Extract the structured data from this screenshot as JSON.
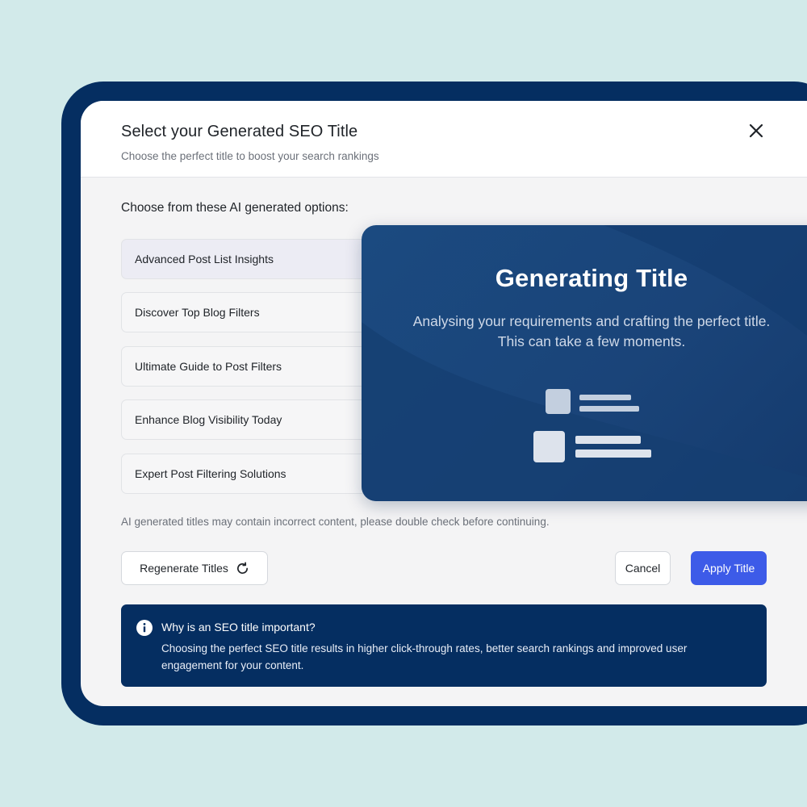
{
  "modal": {
    "title": "Select your Generated SEO Title",
    "subtitle": "Choose the perfect title to boost your search rankings",
    "close_icon": "close-icon"
  },
  "options": {
    "heading": "Choose from these AI generated options:",
    "items": [
      "Advanced Post List Insights",
      "Discover Top Blog Filters",
      "Ultimate Guide to Post Filters",
      "Enhance Blog Visibility Today",
      "Expert Post Filtering Solutions"
    ]
  },
  "disclaimer": "AI generated titles may contain incorrect content, please double check before continuing.",
  "buttons": {
    "regenerate": "Regenerate Titles",
    "regenerate_icon": "refresh-icon",
    "cancel": "Cancel",
    "apply": "Apply Title"
  },
  "info": {
    "icon": "info-icon",
    "title": "Why is an SEO title important?",
    "body": "Choosing the perfect SEO title results in higher click-through rates, better search rankings and improved user engagement for your content."
  },
  "generating": {
    "title": "Generating Title",
    "line1": "Analysing your requirements and crafting the perfect title.",
    "line2": "This can take a few moments.",
    "illustration": "document-lines-icon"
  },
  "colors": {
    "background": "#d2eaea",
    "frame": "#052e61",
    "accent": "#3d5be8",
    "card": "#1b4a80"
  }
}
